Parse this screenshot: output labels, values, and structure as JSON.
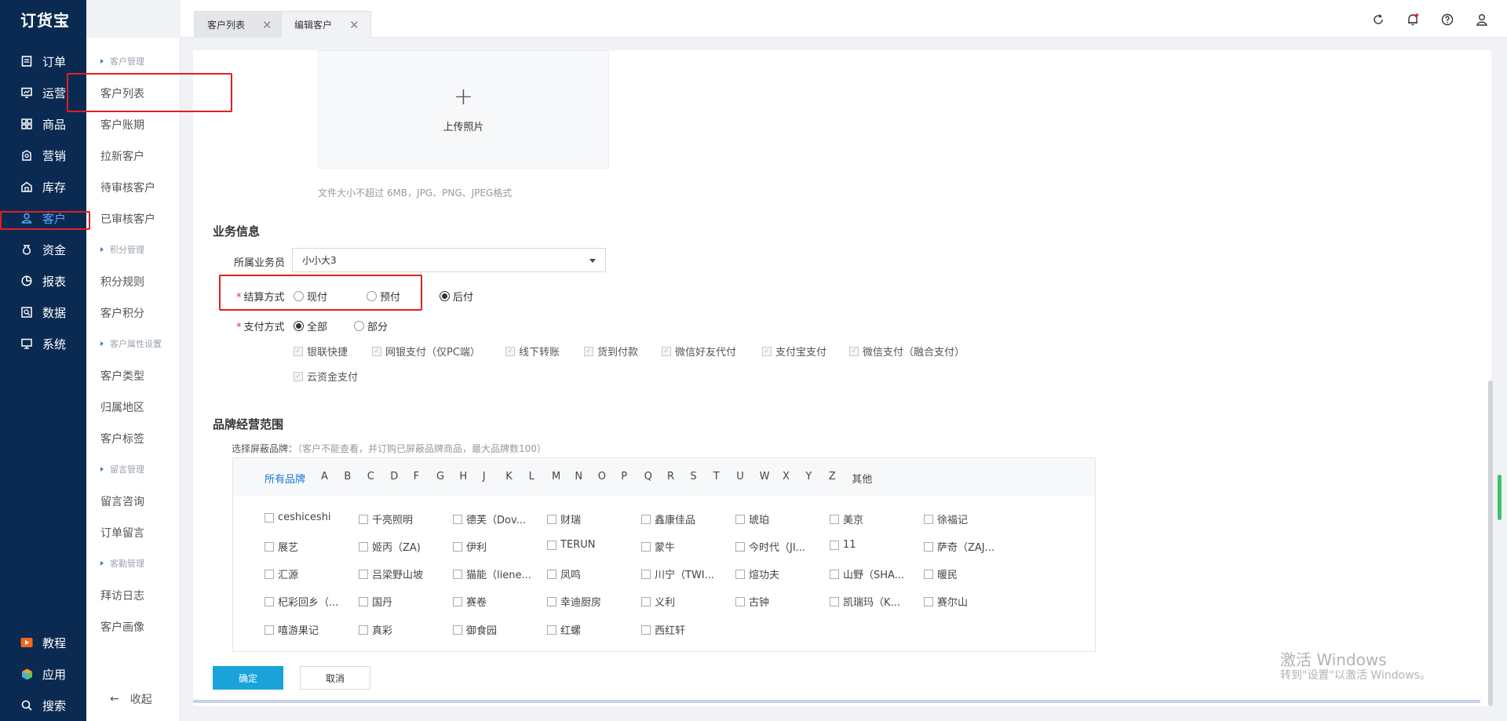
{
  "app": {
    "logo": "订货宝"
  },
  "nav": {
    "items": [
      {
        "label": "订单",
        "icon": "order-icon"
      },
      {
        "label": "运营",
        "icon": "operation-icon"
      },
      {
        "label": "商品",
        "icon": "goods-icon"
      },
      {
        "label": "营销",
        "icon": "marketing-icon"
      },
      {
        "label": "库存",
        "icon": "inventory-icon"
      },
      {
        "label": "客户",
        "icon": "user-icon",
        "active": true
      },
      {
        "label": "资金",
        "icon": "money-icon"
      },
      {
        "label": "报表",
        "icon": "report-icon"
      },
      {
        "label": "数据",
        "icon": "data-icon"
      },
      {
        "label": "系统",
        "icon": "monitor-icon"
      }
    ],
    "bottom": [
      {
        "label": "教程",
        "icon": "video-icon"
      },
      {
        "label": "应用",
        "icon": "apps-icon"
      },
      {
        "label": "搜索",
        "icon": "search-icon"
      }
    ]
  },
  "submenu": {
    "groups": [
      {
        "title": "客户管理",
        "items": [
          "客户列表",
          "客户账期",
          "拉新客户",
          "待审核客户",
          "已审核客户"
        ]
      },
      {
        "title": "积分管理",
        "items": [
          "积分规则",
          "客户积分"
        ]
      },
      {
        "title": "客户属性设置",
        "items": [
          "客户类型",
          "归属地区",
          "客户标签"
        ]
      },
      {
        "title": "留言管理",
        "items": [
          "留言咨询",
          "订单留言"
        ]
      },
      {
        "title": "客勤管理",
        "items": [
          "拜访日志",
          "客户画像"
        ]
      }
    ],
    "collapse_label": "收起"
  },
  "tabs": [
    {
      "label": "客户列表"
    },
    {
      "label": "编辑客户",
      "active": true
    }
  ],
  "header_icons": [
    "refresh-icon",
    "bell-icon",
    "help-icon",
    "user-account-icon"
  ],
  "upload": {
    "label": "上传照片",
    "hint": "文件大小不超过 6MB，JPG、PNG、JPEG格式"
  },
  "business": {
    "title": "业务信息",
    "salesman_label": "所属业务员",
    "salesman_value": "小小大3",
    "settlement_label": "结算方式",
    "settlement_options": [
      "现付",
      "预付",
      "后付"
    ],
    "settlement_selected": "后付",
    "payment_label": "支付方式",
    "payment_options": [
      "全部",
      "部分"
    ],
    "payment_selected": "全部",
    "payment_methods": [
      "银联快捷",
      "网银支付（仅PC端）",
      "线下转账",
      "货到付款",
      "微信好友代付",
      "支付宝支付",
      "微信支付（融合支付）",
      "云资金支付"
    ]
  },
  "brand": {
    "title": "品牌经营范围",
    "select_label": "选择屏蔽品牌：",
    "select_hint": "（客户不能查看，并订购已屏蔽品牌商品，最大品牌数100）",
    "filter_all": "所有品牌",
    "letters": [
      "A",
      "B",
      "C",
      "D",
      "F",
      "G",
      "H",
      "J",
      "K",
      "L",
      "M",
      "N",
      "O",
      "P",
      "Q",
      "R",
      "S",
      "T",
      "U",
      "W",
      "X",
      "Y",
      "Z",
      "其他"
    ],
    "items": [
      "ceshiceshi",
      "千亮照明",
      "德芙（Dov...",
      "财瑞",
      "鑫康佳品",
      "琥珀",
      "美京",
      "徐福记",
      "展艺",
      "姬丙（ZA)",
      "伊利",
      "TERUN",
      "蒙牛",
      "今时代（JI...",
      "11",
      "萨奇（ZAJ...",
      "汇源",
      "吕梁野山坡",
      "猫能（liene...",
      "凤鸣",
      "川宁（TWI...",
      "煊功夫",
      "山野（SHA...",
      "暖民",
      "杞彩回乡（...",
      "国丹",
      "赛卷",
      "幸迪厨房",
      "义利",
      "古钟",
      "凯瑞玛（K...",
      "赛尔山",
      "嘻游果记",
      "真彩",
      "御食园",
      "红螺",
      "西红轩"
    ]
  },
  "actions": {
    "confirm": "确定",
    "cancel": "取消"
  },
  "watermark": {
    "line1": "激活 Windows",
    "line2": "转到\"设置\"以激活 Windows。"
  },
  "colors": {
    "nav_bg": "#0b2a52",
    "accent": "#1aa3d9",
    "highlight_box": "#e02020",
    "active_nav": "#5aa9ff"
  }
}
